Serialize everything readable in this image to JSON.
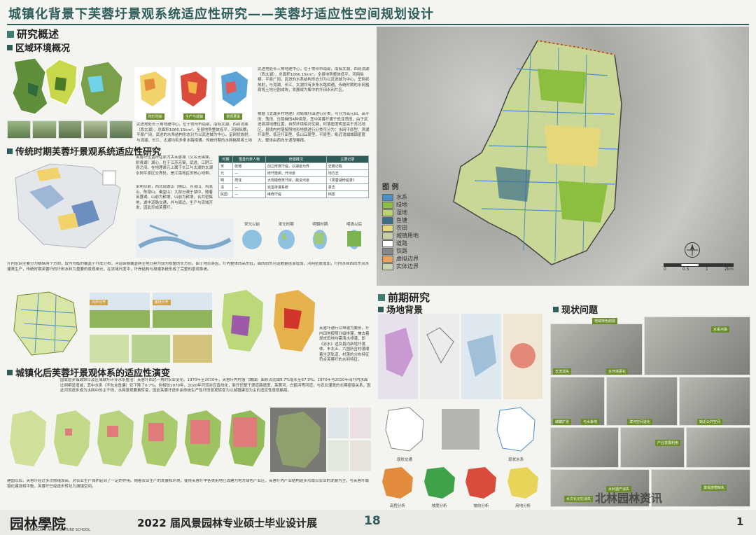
{
  "header": {
    "title": "城镇化背景下芙蓉圩景观系统适应性研究——芙蓉圩适应性空间规划设计"
  },
  "sections": {
    "overview": "研究概述",
    "regional": "区域环境概况",
    "traditional": "传统时期芙蓉圩景观系统适应性研究",
    "urbanized": "城镇化后芙蓉圩景观体系的适应性演变",
    "preliminary": "前期研究",
    "site_bg": "场地背景",
    "problems": "现状问题"
  },
  "regional": {
    "map_labels": [
      "地形地貌",
      "生产与城镇",
      "景观要素"
    ],
    "text1": "武进地处长三角地理中心，位于常州市南部，南临太湖，西到滆湖（西太湖），总面积1066.15km²。全县地势整体低平，河网纵横，平原广阔，武进的水系结构形态分为以武进城为中心，呈网状放射，与滆湖、长江、太湖均有多条水路相通。传统时期的水网格局将土地分割成块，发展成为集中的圩田水利片区。",
    "text2": "根据《太湖乡村地理》对局域圩田进行分类，可分为高元田、高平田、荡田、丘陵梯田4种类型。其中芙蓉圩属于低洼荡田，由于武进县境地理位置，自然环境相对优越，村落密度明显高于苏北地区，县境内村落按照地形地貌进行分类可分为：水网平原型、滨湖圩田型、低洼圩田型、低山丘陵型、平原型。毗近滆湖城镇密度大，整体由西向东递渐稀疏。"
  },
  "traditional": {
    "text1": "芙蓉圩位置所在原为古芙蓉湖（又名无锡湖、射贵湖）湖心，位于江苏无锡、武进、江阴三县之间。在地理单元上属于长江与太湖的太湖水网平原区交界处，是江南地区的核心地带。",
    "text2": "宋明以前，西北部湖山（横山、芳茂山、鸡笼山、陈墩山、秦望山）大部分濒于湖中，随着芙蓉湖、山前为耕埂，山前为耕埂，合并密集地，湖中道路交通，并与周边，生产与流域开发，因此形成芙蓉圩。",
    "table_headers": [
      "时期",
      "围垦代表人物",
      "修建概况",
      "主要记录"
    ],
    "table_rows": [
      [
        "宋",
        "张镈",
        "创立修筑圩堤，以湖道为界",
        "史籍记载"
      ],
      [
        "元",
        "—",
        "修圩建闸，开河道",
        "地方志"
      ],
      [
        "明",
        "周忱",
        "大规模修筑圩岸，疏浚河道",
        "《芙蓉湖修堤录》"
      ],
      [
        "清",
        "—",
        "完善排灌系统",
        "县志"
      ],
      [
        "民国",
        "—",
        "维修圩堤",
        "档案"
      ]
    ],
    "diagram_labels": [
      "宋元以前",
      "宋元时期",
      "明朝时期",
      "明清以后"
    ],
    "bottom_text": "圩内水网主要分为横纵两个方向，较为均衡的覆盖于圩岸分布，河道纵横覆盖两主地分割为较为规整的长方形。由于地形原因，圩内整体西高东低，由西向东河道数量逐渐增加，河网密度增加，圩内水自西向东流水灌溉生产，传统时期芙蓉圩的圩田水利为重要的景观单元，在流域尺度中，圩岸结构与排灌系统形成了完整的景观系统。",
    "section_labels": [
      "内外分开",
      "灌排分开"
    ],
    "right_text": "芙蓉圩通行以排灌为要务，圩内田地按照分级排灌，兼去着堤岸田地均需清水排灌，即《治水》述及县内新增圩落体，丰北五，六固所含村落顺着生活轨道，村落的分布特征符合芙蓉圩的水利特征。"
  },
  "urbanized": {
    "text": "国家层乡镇政策以及区域联圩环评水系整治：芙蓉圩西北一角的农业变化。1970年至2010年，芙蓉圩内村落（城镇）面积占比由9.7%增长至67.9%。1970年与2020年间圩内水面比例明显增减，其中水系（不包含鱼塘）仅下降了0.7%。但相较1970年，2020年河流对应直线化，新开挖整干渠道路速度，芙蓉河、白鹤河等河道，与农业灌溉的长期密接关系，因此河流逐步成为水网中的主干线，水网景观要素转变，因此芙蓉圩逐步由传统生产性圩田景观转变为以城镇建设为主的适应性景观格局。",
    "bottom_text": "建国以后，芙蓉圩经过多次修缮加高、对农业生产保护起到了一定的作用。随着农业生产的发展和环境，使得芙蓉圩中各类用地已改建为地方绿色产业区，芙蓉圩内产业结构逐步形成以农业的发展为主，与芙蓉圩城镇化建设相平衡，芙蓉圩已经逐步转化为城镇空间。"
  },
  "site": {
    "labels": [
      "现状交通",
      "现状水系",
      "高程分析",
      "坡度分析",
      "坡向分析",
      "用地分析"
    ]
  },
  "problems": {
    "labels": [
      "地域特色削弱",
      "水系污染",
      "支流消失",
      "水环境恶化",
      "城镇扩张",
      "与水争地",
      "滨河空间退化",
      "缺乏公共空间",
      "产业发展利用",
      "水文化记忆消失",
      "水利遗产消失",
      "景观游憩缺失"
    ]
  },
  "legend": {
    "title": "图  例",
    "items": [
      {
        "label": "水系",
        "color": "#4a8fc9"
      },
      {
        "label": "绿地",
        "color": "#8cbf3f"
      },
      {
        "label": "湿地",
        "color": "#b8d46a"
      },
      {
        "label": "鱼塘",
        "color": "#3c6e8a"
      },
      {
        "label": "农田",
        "color": "#e6d77a"
      },
      {
        "label": "城镇用地",
        "color": "#c9cfa9"
      },
      {
        "label": "道路",
        "color": "#ffffff"
      },
      {
        "label": "铁路",
        "color": "#888888"
      },
      {
        "label": "虚拟边界",
        "color": "#e9a35b"
      },
      {
        "label": "实体边界",
        "color": "#c9d3b0"
      }
    ]
  },
  "scale": {
    "ticks": [
      "0",
      "0.5",
      "1",
      "2km"
    ]
  },
  "footer": {
    "school": "园林學院",
    "school_en": "LANDSCAPE ARCHITECTURE SCHOOL",
    "exhibition": "2022 届风景园林专业硕士毕业设计展",
    "number": "18",
    "watermark": "北林园林资讯",
    "page": "1"
  }
}
